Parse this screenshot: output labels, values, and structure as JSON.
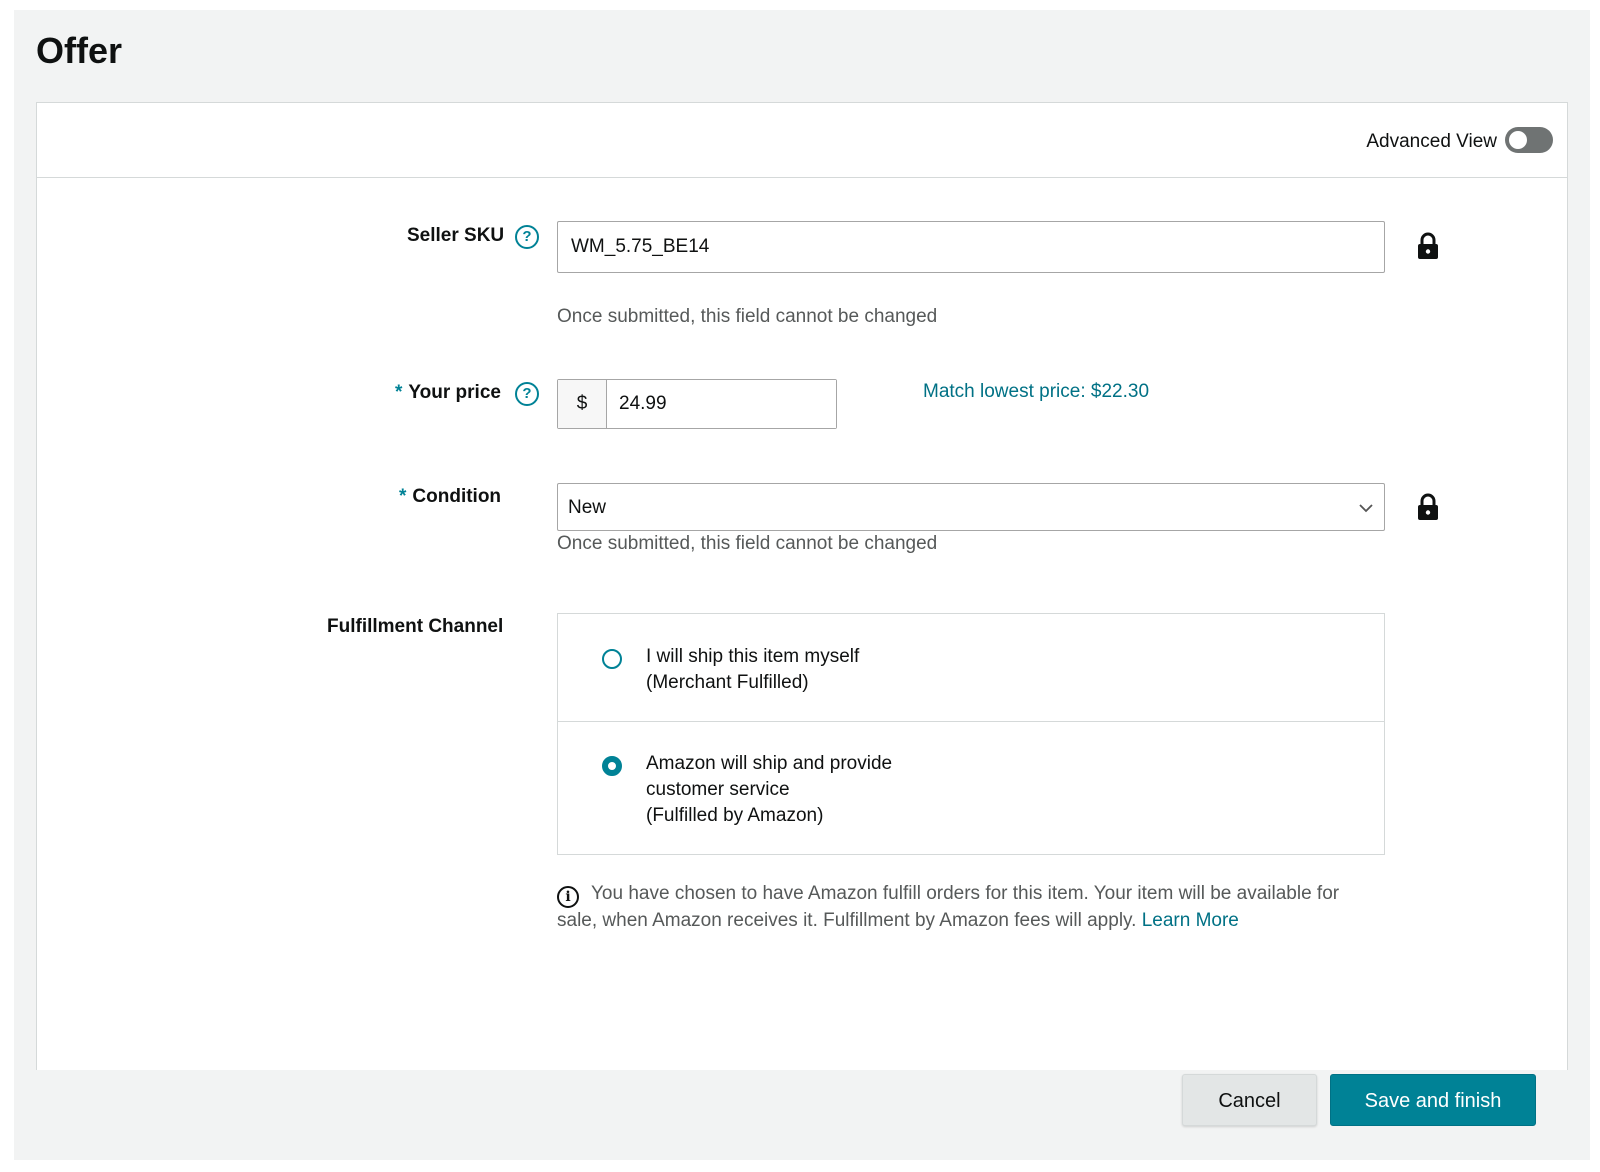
{
  "page": {
    "title": "Offer"
  },
  "header": {
    "advanced_view_label": "Advanced View",
    "advanced_view_on": false
  },
  "form": {
    "sku": {
      "label": "Seller SKU",
      "value": "WM_5.75_BE14",
      "hint": "Once submitted, this field cannot be changed"
    },
    "price": {
      "required_mark": "*",
      "label": "Your price",
      "currency": "$",
      "value": "24.99",
      "match_link": "Match lowest price: $22.30"
    },
    "condition": {
      "required_mark": "*",
      "label": "Condition",
      "value": "New",
      "hint": "Once submitted, this field cannot be changed"
    },
    "fulfillment": {
      "label": "Fulfillment Channel",
      "options": [
        {
          "line1": "I will ship this item myself",
          "line2": "(Merchant Fulfilled)",
          "selected": false
        },
        {
          "line1": "Amazon will ship and provide",
          "line2": "customer service",
          "line3": "(Fulfilled by Amazon)",
          "selected": true
        }
      ],
      "info_text": "You have chosen to have Amazon fulfill orders for this item. Your item will be available for sale, when Amazon receives it. Fulfillment by Amazon fees will apply.",
      "learn_more": "Learn More"
    }
  },
  "footer": {
    "cancel_label": "Cancel",
    "save_label": "Save and finish"
  },
  "colors": {
    "accent": "#008296",
    "link": "#007185",
    "hint": "#565959",
    "toggle_off": "#6f7373"
  },
  "icons": [
    "help-icon",
    "lock-icon",
    "chevron-down-icon",
    "info-icon",
    "radio-icon"
  ]
}
